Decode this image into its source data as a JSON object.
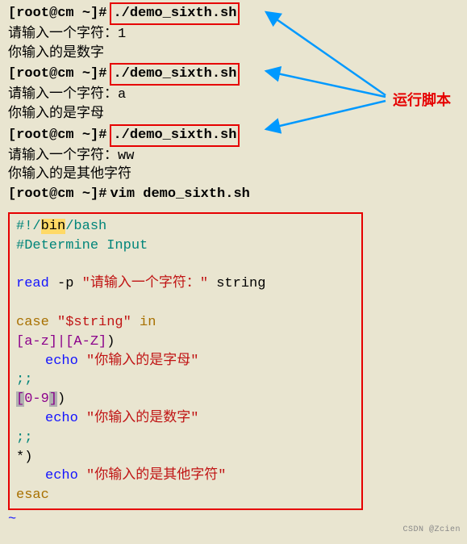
{
  "prompts": {
    "root_open": "[root@cm",
    "tilde": "~",
    "hash": "]#",
    "boxed_cmd": "./demo_sixth.sh",
    "vim_cmd": "vim demo_sixth.sh"
  },
  "io": {
    "ask": "请输入一个字符：",
    "input1": "1",
    "reply1": "你输入的是数字",
    "input2": "a",
    "reply2": "你输入的是字母",
    "input3": "ww",
    "reply3": "你输入的是其他字符"
  },
  "script": {
    "shebang_pre": "#!/",
    "shebang_bin": "bin",
    "shebang_post": "/bash",
    "comment": "#Determine Input",
    "read_kw": "read",
    "read_flag": " -p ",
    "read_prompt": "\"请输入一个字符：\"",
    "read_var": " string",
    "case_kw": "case",
    "case_var": " \"$string\" ",
    "case_in": "in",
    "pat1": "[a-z]|[A-Z]",
    "paren": ")",
    "echo_kw": "echo",
    "echo1": " \"你输入的是字母\"",
    "sep": ";;",
    "pat2_open": "[",
    "pat2_body": "0-9",
    "pat2_close": "]",
    "echo2": " \"你输入的是数字\"",
    "pat3": "*",
    "echo3": " \"你输入的是其他字符\"",
    "esac": "esac",
    "tilde": "~"
  },
  "annotation": {
    "label": "运行脚本"
  },
  "watermark": "CSDN @Zcien"
}
